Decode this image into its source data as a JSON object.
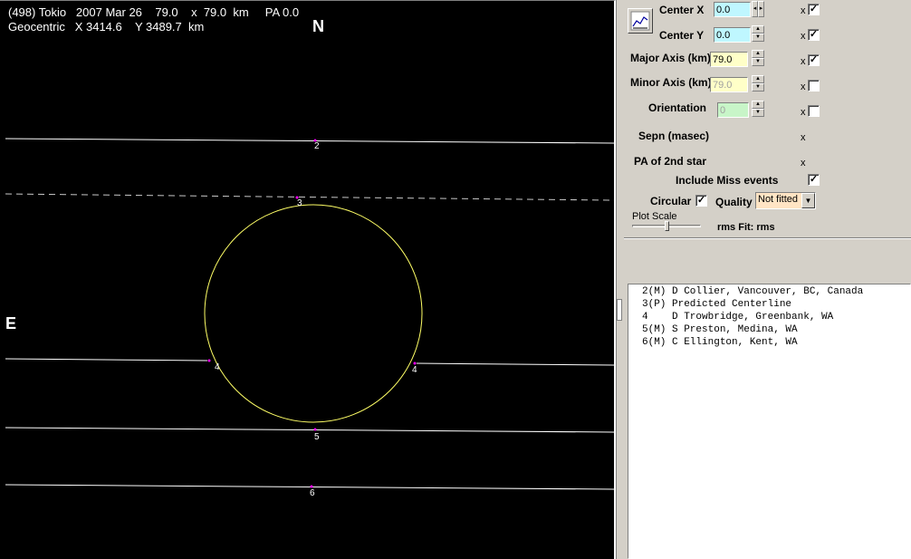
{
  "plot": {
    "header_line1": "(498) Tokio   2007 Mar 26    79.0    x  79.0  km     PA 0.0",
    "header_line2": "Geocentric   X 3414.6    Y 3489.7  km",
    "north_label": "N",
    "east_label": "E",
    "chord_labels": [
      "2",
      "3",
      "4",
      "4",
      "5",
      "6"
    ],
    "colors": {
      "background": "#000000",
      "chord": "#ffffff",
      "ellipse": "#ffff66",
      "marker": "#ff00ff"
    }
  },
  "panel": {
    "center_x": {
      "label": "Center X",
      "value": "0.0",
      "x": "x",
      "checked": true
    },
    "center_y": {
      "label": "Center Y",
      "value": "0.0",
      "x": "x",
      "checked": true
    },
    "major_axis": {
      "label": "Major Axis (km)",
      "value": "79.0",
      "x": "x",
      "checked": true
    },
    "minor_axis": {
      "label": "Minor Axis (km)",
      "value": "79.0",
      "x": "x",
      "checked": false
    },
    "orientation": {
      "label": "Orientation",
      "value": "0",
      "x": "x",
      "checked": false
    },
    "sepn": {
      "label": "Sepn (masec)",
      "x": "x"
    },
    "pa2": {
      "label": "PA of 2nd star",
      "x": "x"
    },
    "include_miss": {
      "label": "Include Miss events",
      "checked": true
    },
    "circular": {
      "label": "Circular",
      "checked": true
    },
    "quality": {
      "label": "Quality",
      "value": "Not fitted"
    },
    "plot_scale": {
      "label": "Plot Scale"
    },
    "rms_fit": "rms Fit: rms",
    "plot_icon": "line-chart-icon"
  },
  "observers": [
    "2(M) D Collier, Vancouver, BC, Canada",
    "3(P) Predicted Centerline",
    "4    D Trowbridge, Greenbank, WA",
    "5(M) S Preston, Medina, WA",
    "6(M) C Ellington, Kent, WA"
  ]
}
